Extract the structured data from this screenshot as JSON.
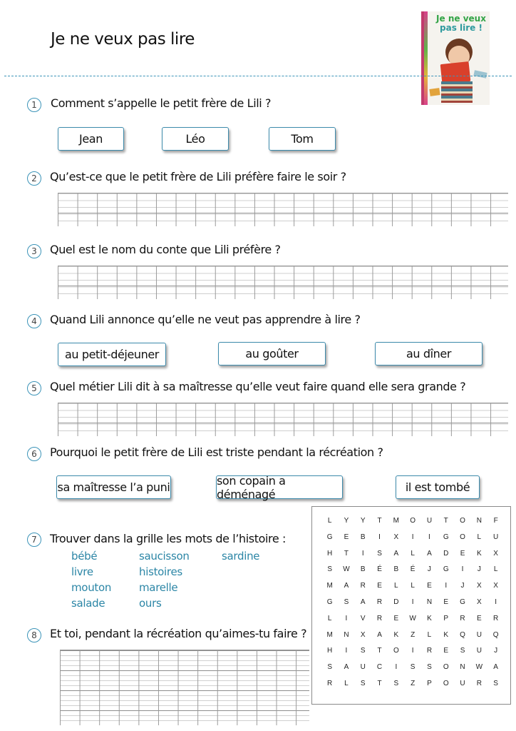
{
  "title": "Je ne veux pas lire",
  "cover": {
    "title_line1": "Je ne veux",
    "title_line2": "pas lire !"
  },
  "questions": [
    {
      "number": "1",
      "text": "Comment s’appelle le petit frère de Lili ?",
      "choices": [
        "Jean",
        "Léo",
        "Tom"
      ]
    },
    {
      "number": "2",
      "text": "Qu’est-ce que le petit frère de Lili préfère faire le soir ?"
    },
    {
      "number": "3",
      "text": "Quel est le nom du conte que Lili préfère ?"
    },
    {
      "number": "4",
      "text": "Quand Lili annonce qu’elle ne veut pas apprendre à lire ?",
      "choices": [
        "au petit-déjeuner",
        "au goûter",
        "au dîner"
      ]
    },
    {
      "number": "5",
      "text": "Quel métier Lili dit à sa maîtresse qu’elle veut faire quand elle sera grande ?"
    },
    {
      "number": "6",
      "text": "Pourquoi le petit frère de Lili est triste pendant la récréation ?",
      "choices": [
        "sa maîtresse l’a puni",
        "son copain a déménagé",
        "il est tombé"
      ]
    },
    {
      "number": "7",
      "text": "Trouver dans la grille les mots de l’histoire :",
      "words": [
        "bébé",
        "saucisson",
        "sardine",
        "livre",
        "histoires",
        "mouton",
        "marelle",
        "salade",
        "ours"
      ]
    },
    {
      "number": "8",
      "text": "Et toi, pendant la récréation qu’aimes-tu faire ?"
    }
  ],
  "word_search": {
    "rows": [
      [
        "L",
        "Y",
        "Y",
        "T",
        "M",
        "O",
        "U",
        "T",
        "O",
        "N",
        "F"
      ],
      [
        "G",
        "E",
        "B",
        "I",
        "X",
        "I",
        "I",
        "G",
        "O",
        "L",
        "U"
      ],
      [
        "H",
        "T",
        "I",
        "S",
        "A",
        "L",
        "A",
        "D",
        "E",
        "K",
        "X"
      ],
      [
        "S",
        "W",
        "B",
        "É",
        "B",
        "É",
        "J",
        "G",
        "I",
        "J",
        "L"
      ],
      [
        "M",
        "A",
        "R",
        "E",
        "L",
        "L",
        "E",
        "I",
        "J",
        "X",
        "X"
      ],
      [
        "G",
        "S",
        "A",
        "R",
        "D",
        "I",
        "N",
        "E",
        "G",
        "X",
        "I"
      ],
      [
        "L",
        "I",
        "V",
        "R",
        "E",
        "W",
        "K",
        "P",
        "R",
        "E",
        "R"
      ],
      [
        "M",
        "N",
        "X",
        "A",
        "K",
        "Z",
        "L",
        "K",
        "Q",
        "U",
        "Q"
      ],
      [
        "H",
        "I",
        "S",
        "T",
        "O",
        "I",
        "R",
        "E",
        "S",
        "U",
        "J"
      ],
      [
        "S",
        "A",
        "U",
        "C",
        "I",
        "S",
        "S",
        "O",
        "N",
        "W",
        "A"
      ],
      [
        "R",
        "L",
        "S",
        "T",
        "S",
        "Z",
        "P",
        "O",
        "U",
        "R",
        "S"
      ]
    ]
  },
  "colors": {
    "accent": "#3c94b8",
    "word_list": "#2c86a6",
    "button_border": "#3c8aab"
  }
}
